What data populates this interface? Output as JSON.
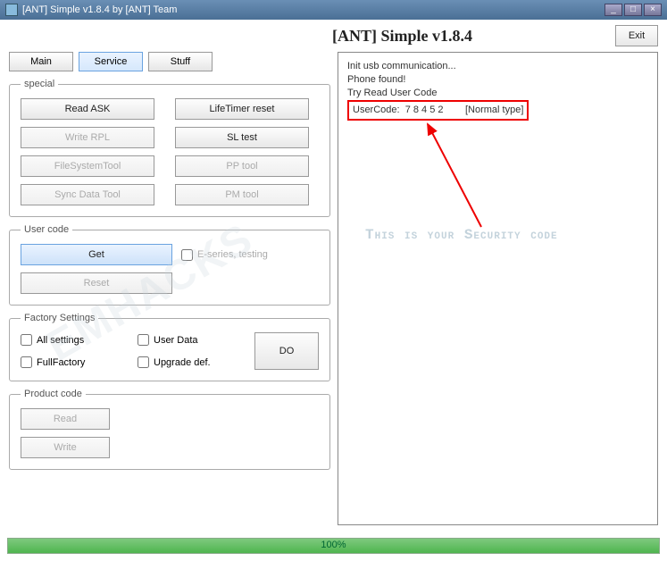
{
  "window": {
    "title": "[ANT] Simple v1.8.4 by [ANT] Team"
  },
  "header": {
    "app_title": "[ANT] Simple v1.8.4",
    "exit": "Exit"
  },
  "tabs": {
    "main": "Main",
    "service": "Service",
    "stuff": "Stuff"
  },
  "special": {
    "legend": "special",
    "read_ask": "Read ASK",
    "lifetimer": "LifeTimer reset",
    "write_rpl": "Write RPL",
    "sl_test": "SL test",
    "filesystemtool": "FileSystemTool",
    "pp_tool": "PP tool",
    "sync_data": "Sync Data Tool",
    "pm_tool": "PM tool"
  },
  "usercode": {
    "legend": "User code",
    "get": "Get",
    "reset": "Reset",
    "eseries": "E-series, testing"
  },
  "factory": {
    "legend": "Factory Settings",
    "all_settings": "All settings",
    "user_data": "User Data",
    "full_factory": "FullFactory",
    "upgrade_def": "Upgrade def.",
    "do": "DO"
  },
  "product": {
    "legend": "Product code",
    "read": "Read",
    "write": "Write"
  },
  "log": {
    "line1": "Init usb communication...",
    "line2": "Phone found!",
    "line3": "Try Read User Code",
    "usercode_label": "UserCode:",
    "usercode_value": "7 8 4 5 2",
    "usercode_type": "[Normal type]"
  },
  "annotation": "This is your Security code",
  "watermark": "EMHACKS",
  "progress": {
    "percent": "100%",
    "value": 100
  }
}
